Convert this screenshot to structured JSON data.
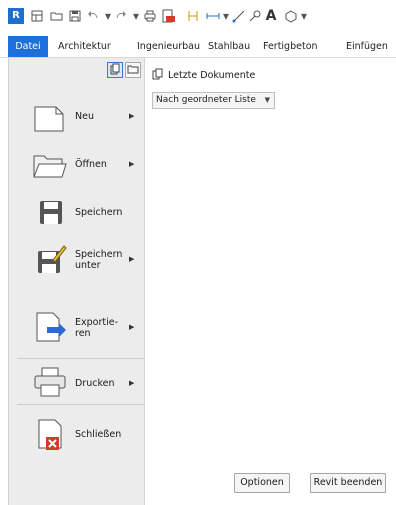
{
  "app": {
    "logo_letter": "R"
  },
  "ribbon": {
    "tabs": [
      {
        "label": "Datei",
        "active": true
      },
      {
        "label": "Architektur"
      },
      {
        "label": "Ingenieurbau"
      },
      {
        "label": "Stahlbau"
      },
      {
        "label": "Fertigbeton"
      },
      {
        "label": "Einfügen"
      }
    ]
  },
  "menu": {
    "items": [
      {
        "label": "Neu",
        "has_submenu": true,
        "icon": "new-document-icon"
      },
      {
        "label": "Öffnen",
        "has_submenu": true,
        "icon": "open-folder-icon"
      },
      {
        "label": "Speichern",
        "has_submenu": false,
        "icon": "save-icon"
      },
      {
        "label_line1": "Speichern",
        "label_line2": "unter",
        "has_submenu": true,
        "icon": "save-as-icon"
      },
      {
        "label_line1": "Exportie-",
        "label_line2": "ren",
        "has_submenu": true,
        "icon": "export-icon"
      },
      {
        "label": "Drucken",
        "has_submenu": true,
        "icon": "print-icon"
      },
      {
        "label": "Schließen",
        "has_submenu": false,
        "icon": "close-document-icon"
      }
    ]
  },
  "recent": {
    "title": "Letzte Dokumente",
    "sort_value": "Nach geordneter Liste"
  },
  "footer": {
    "options_label": "Optionen",
    "exit_label": "Revit beenden"
  },
  "colors": {
    "accent": "#1e6fd9",
    "menu_bg": "#ececec"
  }
}
